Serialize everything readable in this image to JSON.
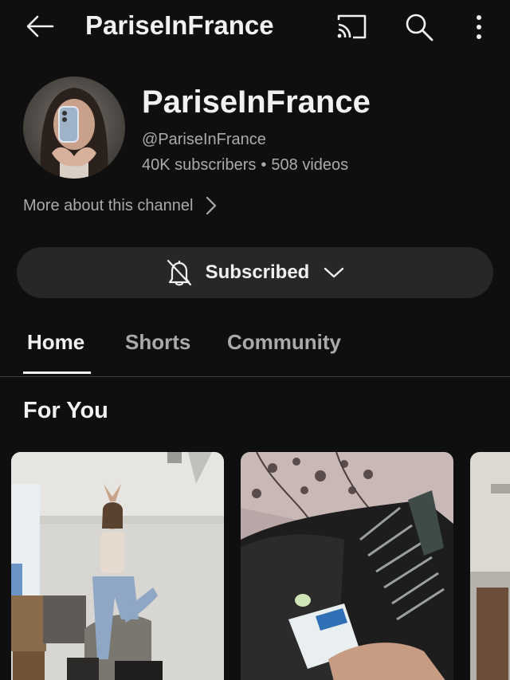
{
  "topbar": {
    "title": "PariseInFrance",
    "icons": [
      "back-arrow-icon",
      "cast-icon",
      "search-icon",
      "more-vert-icon"
    ]
  },
  "channel": {
    "name": "PariseInFrance",
    "handle": "@PariseInFrance",
    "subscribers": "40K subscribers",
    "separator": "•",
    "videos": "508 videos",
    "more_about": "More about this channel"
  },
  "subscribe_button": {
    "label": "Subscribed",
    "icon": "bell-off-icon"
  },
  "tabs": [
    {
      "label": "Home",
      "active": true
    },
    {
      "label": "Shorts",
      "active": false
    },
    {
      "label": "Community",
      "active": false
    }
  ],
  "section": {
    "title": "For You"
  },
  "colors": {
    "background": "#0f0f0f",
    "text_primary": "#f1f1f1",
    "text_secondary": "#aaaaaa",
    "button_bg": "#272727"
  }
}
